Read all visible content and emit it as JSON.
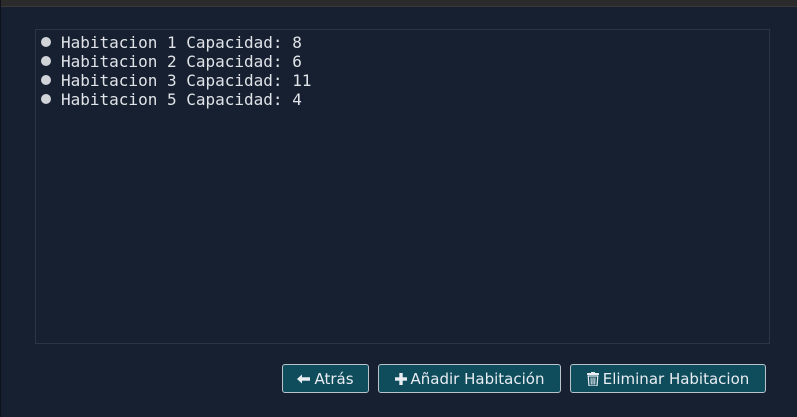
{
  "rooms": [
    {
      "label": "Habitacion 1 Capacidad: 8"
    },
    {
      "label": "Habitacion 2 Capacidad: 6"
    },
    {
      "label": "Habitacion 3 Capacidad: 11"
    },
    {
      "label": "Habitacion 5 Capacidad: 4"
    }
  ],
  "buttons": {
    "back": {
      "label": "Atrás",
      "icon": "arrow-left-icon"
    },
    "add": {
      "label": "Añadir Habitación",
      "icon": "plus-icon"
    },
    "delete": {
      "label": "Eliminar Habitacion",
      "icon": "trash-icon"
    }
  },
  "colors": {
    "background": "#172030",
    "button": "#0f4c5c",
    "text": "#e0e3e8"
  }
}
